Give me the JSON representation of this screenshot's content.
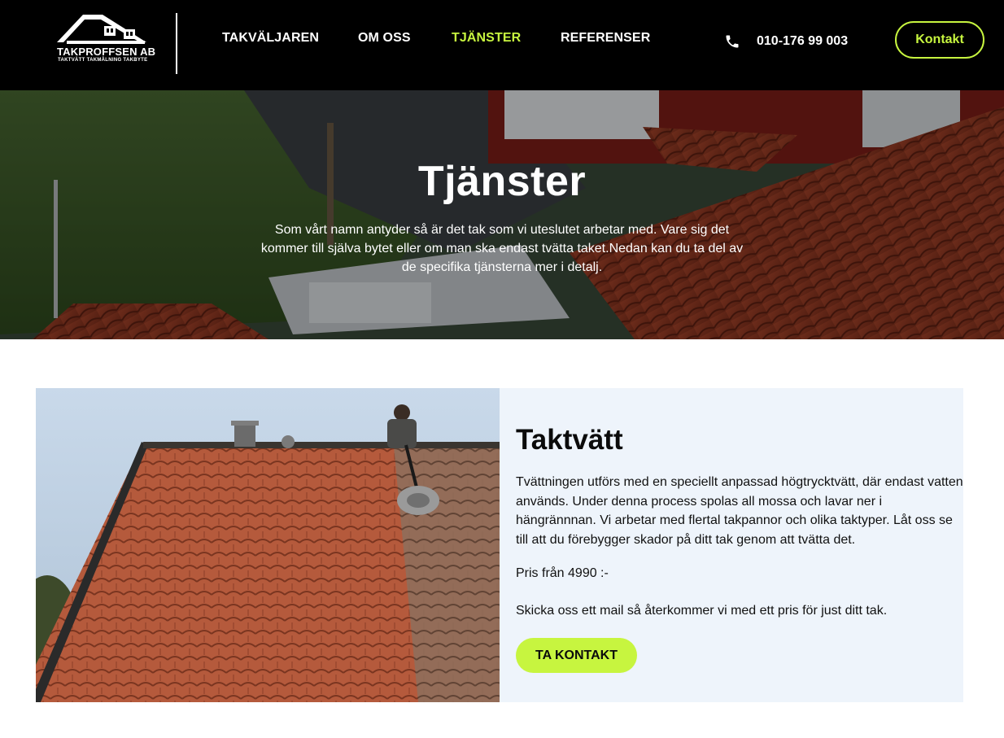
{
  "brand": {
    "name": "TAKPROFFSEN AB",
    "tagline": "TAKTVÄTT  TAKMÅLNING  TAKBYTE"
  },
  "nav": {
    "items": [
      {
        "label": "TAKVÄLJAREN",
        "active": false
      },
      {
        "label": "OM OSS",
        "active": false
      },
      {
        "label": "TJÄNSTER",
        "active": true
      },
      {
        "label": "REFERENSER",
        "active": false
      }
    ],
    "phone": "010-176 99 003",
    "contact_button": "Kontakt"
  },
  "hero": {
    "title": "Tjänster",
    "text": "Som vårt namn antyder så är det tak som vi uteslutet arbetar med. Vare sig det kommer till själva bytet eller om man ska endast tvätta taket.Nedan kan du ta del av de specifika tjänsterna mer i detalj."
  },
  "service": {
    "title": "Taktvätt",
    "description": "Tvättningen utförs med en speciellt anpassad högtrycktvätt, där endast vatten används. Under denna process spolas all mossa och lavar ner i hängrännnan. Vi arbetar med flertal takpannor och olika taktyper. Låt oss se till att du förebygger skador på ditt tak genom att tvätta det.",
    "price": "Pris från 4990 :-",
    "mail_text": "Skicka oss ett mail så återkommer vi med ett pris för just ditt tak.",
    "cta": "TA KONTAKT"
  },
  "colors": {
    "header_bg": "#000000",
    "accent": "#c7f53f",
    "card_bg": "#eef4fb",
    "text": "#111111"
  },
  "icons": {
    "phone": "phone-icon",
    "logo": "house-roof-icon"
  }
}
